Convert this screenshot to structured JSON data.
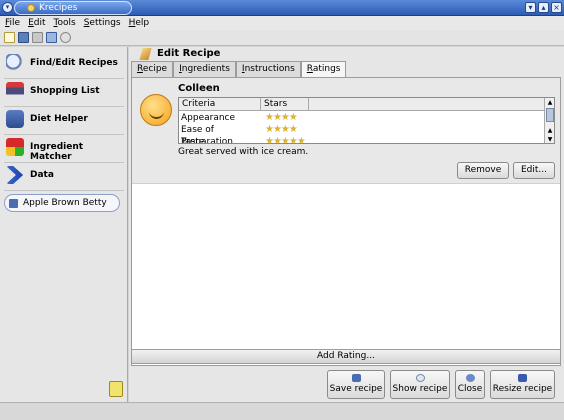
{
  "window": {
    "title": "Krecipes"
  },
  "menu": [
    {
      "label": "File",
      "u": "F",
      "rest": "ile"
    },
    {
      "label": "Edit",
      "u": "E",
      "rest": "dit"
    },
    {
      "label": "Tools",
      "u": "T",
      "rest": "ools"
    },
    {
      "label": "Settings",
      "u": "S",
      "rest": "ettings"
    },
    {
      "label": "Help",
      "u": "H",
      "rest": "elp"
    }
  ],
  "sidebar": {
    "items": [
      {
        "label": "Find/Edit Recipes",
        "icon": "magnifier-icon"
      },
      {
        "label": "Shopping List",
        "icon": "shopping-cart-icon"
      },
      {
        "label": "Diet Helper",
        "icon": "diet-icon"
      },
      {
        "label": "Ingredient Matcher",
        "icon": "ingredient-matcher-icon"
      },
      {
        "label": "Data",
        "icon": "data-arrows-icon"
      }
    ],
    "open_recipe": "Apple Brown Betty"
  },
  "editor": {
    "header": "Edit Recipe",
    "tabs": [
      {
        "u": "R",
        "rest": "ecipe"
      },
      {
        "u": "I",
        "rest": "ngredients"
      },
      {
        "u": "I",
        "rest": "nstructions"
      },
      {
        "u": "R",
        "rest": "atings"
      }
    ],
    "active_tab": 3
  },
  "rating": {
    "rater": "Colleen",
    "columns": [
      "Criteria",
      "Stars"
    ],
    "rows": [
      {
        "criteria": "Appearance",
        "stars": "★★★★"
      },
      {
        "criteria": "Ease of Preparation",
        "stars": "★★★★"
      },
      {
        "criteria": "Taste",
        "stars": "★★★★★"
      }
    ],
    "comment": "Great served with ice cream.",
    "remove_label": "Remove",
    "edit_label": "Edit..."
  },
  "add_rating_label": "Add Rating...",
  "bottom": {
    "save": "Save recipe",
    "show": "Show recipe",
    "close": "Close",
    "resize": "Resize recipe"
  },
  "colors": {
    "titlebar": "#2c5bb4",
    "star": "#d8b23a"
  }
}
